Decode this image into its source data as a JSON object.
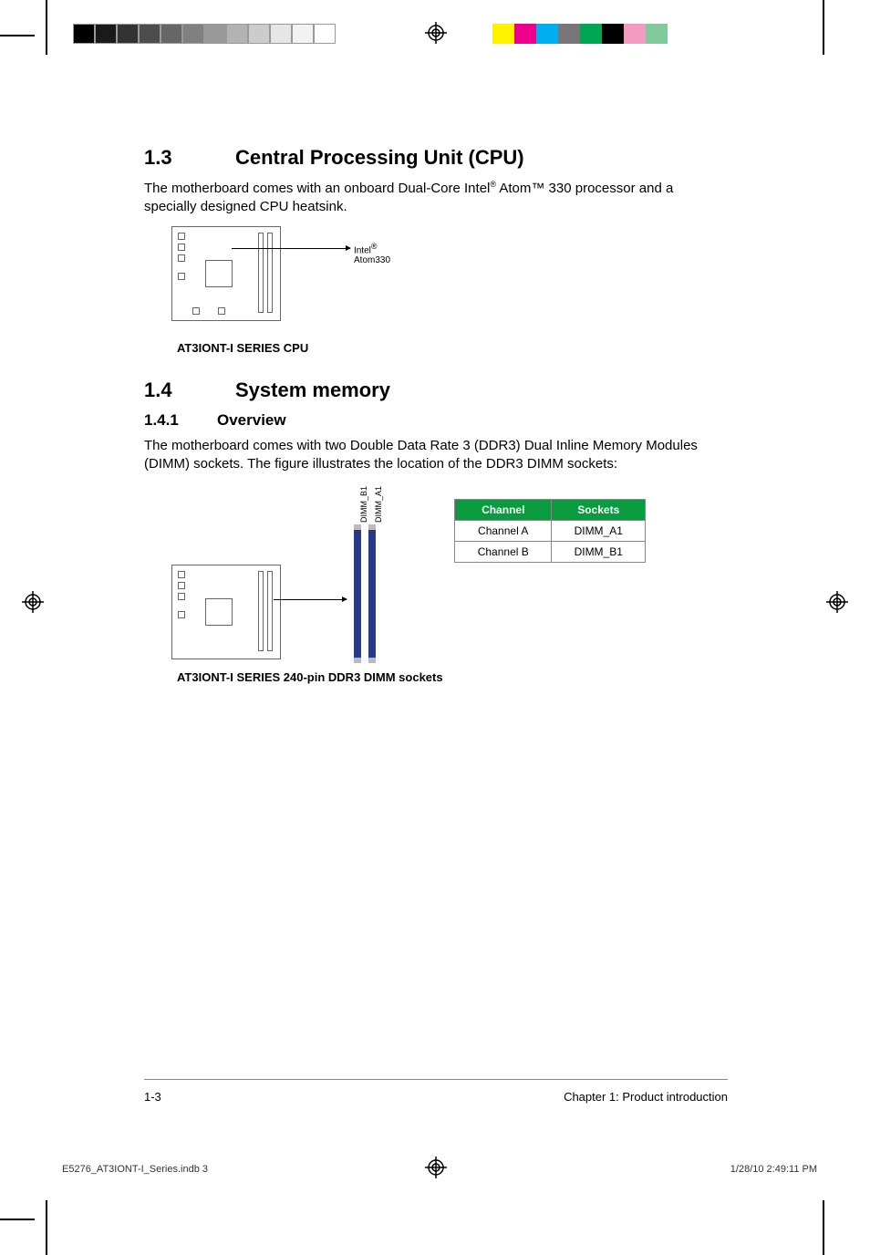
{
  "section13": {
    "number": "1.3",
    "title": "Central Processing Unit (CPU)",
    "body_pre": "The motherboard comes with an onboard Dual-Core Intel",
    "body_sup": "®",
    "body_post": " Atom™ 330 processor and a specially designed CPU heatsink.",
    "diagram_label_pre": "Intel",
    "diagram_label_sup": "®",
    "diagram_label_post": " Atom330",
    "diagram_caption": "AT3IONT-I SERIES CPU"
  },
  "section14": {
    "number": "1.4",
    "title": "System memory",
    "sub_number": "1.4.1",
    "sub_title": "Overview",
    "body": "The motherboard comes with two Double Data Rate 3 (DDR3) Dual Inline Memory Modules (DIMM) sockets. The figure illustrates the location of the DDR3 DIMM sockets:",
    "dimm_labels": [
      "DIMM_B1",
      "DIMM_A1"
    ],
    "diagram_caption": "AT3IONT-I SERIES 240-pin DDR3 DIMM sockets"
  },
  "table": {
    "headers": [
      "Channel",
      "Sockets"
    ],
    "rows": [
      [
        "Channel A",
        "DIMM_A1"
      ],
      [
        "Channel B",
        "DIMM_B1"
      ]
    ]
  },
  "footer": {
    "page": "1-3",
    "chapter": "Chapter 1: Product introduction"
  },
  "printfoot": {
    "file": "E5276_AT3IONT-I_Series.indb   3",
    "datetime": "1/28/10   2:49:11 PM"
  },
  "colorbar_left": [
    "#000",
    "#1a1a1a",
    "#333",
    "#4d4d4d",
    "#666",
    "#808080",
    "#999",
    "#b3b3b3",
    "#ccc",
    "#e6e6e6",
    "#f2f2f2",
    "#fff"
  ],
  "colorbar_right": [
    "#fff200",
    "#ec008c",
    "#00aeef",
    "#777",
    "#00a651",
    "#000",
    "#f49ac1",
    "#82ca9c",
    "#fff"
  ]
}
